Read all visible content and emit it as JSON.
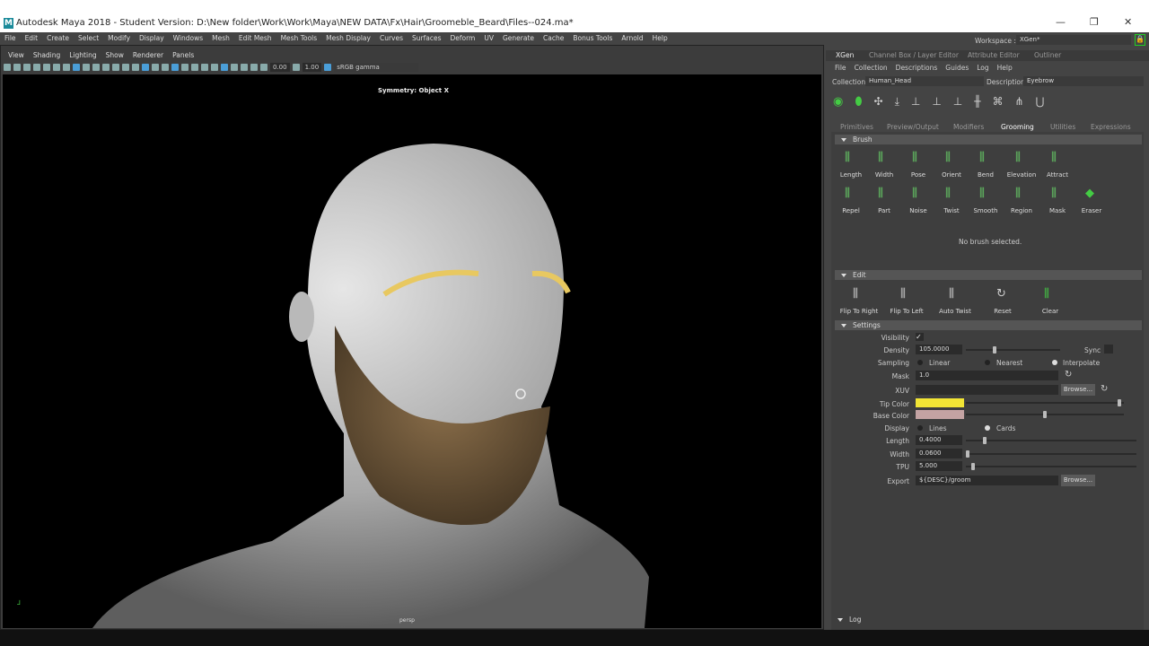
{
  "window": {
    "title": "Autodesk Maya 2018 - Student Version: D:\\New folder\\Work\\Work\\Maya\\NEW DATA\\Fx\\Hair\\Groomeble_Beard\\Files--024.ma*",
    "logo": "M"
  },
  "menu": [
    "File",
    "Edit",
    "Create",
    "Select",
    "Modify",
    "Display",
    "Windows",
    "Mesh",
    "Edit Mesh",
    "Mesh Tools",
    "Mesh Display",
    "Curves",
    "Surfaces",
    "Deform",
    "UV",
    "Generate",
    "Cache",
    "Bonus Tools",
    "Arnold",
    "Help"
  ],
  "panel_menu": [
    "View",
    "Shading",
    "Lighting",
    "Show",
    "Renderer",
    "Panels"
  ],
  "toolbar": {
    "exposure": "0.00",
    "gamma": "1.00",
    "color_space": "sRGB gamma"
  },
  "viewport": {
    "symmetry": "Symmetry: Object X",
    "camera": "persp"
  },
  "workspace": {
    "label": "Workspace :",
    "value": "XGen*"
  },
  "right_tabs": [
    "XGen",
    "Channel Box / Layer Editor",
    "Attribute Editor",
    "Outliner"
  ],
  "xgen_menu": [
    "File",
    "Collection",
    "Descriptions",
    "Guides",
    "Log",
    "Help"
  ],
  "collection": {
    "label": "Collection",
    "value": "Human_Head"
  },
  "description": {
    "label": "Description",
    "value": "Eyebrow"
  },
  "sub_tabs": [
    "Primitives",
    "Preview/Output",
    "Modifiers",
    "Grooming",
    "Utilities",
    "Expressions"
  ],
  "brush": {
    "title": "Brush",
    "tools": [
      "Length",
      "Width",
      "Pose",
      "Orient",
      "Bend",
      "Elevation",
      "Attract",
      "Repel",
      "Part",
      "Noise",
      "Twist",
      "Smooth",
      "Region",
      "Mask",
      "Eraser"
    ],
    "status": "No brush selected."
  },
  "edit": {
    "title": "Edit",
    "tools": [
      "Flip To Right",
      "Flip To Left",
      "Auto Twist",
      "Reset",
      "Clear"
    ]
  },
  "settings": {
    "title": "Settings",
    "visibility": "Visibility",
    "density_label": "Density",
    "density": "105.0000",
    "density_slider": 0.3,
    "sync": "Sync",
    "sampling": "Sampling",
    "sampling_opts": [
      "Linear",
      "Nearest",
      "Interpolate"
    ],
    "mask_label": "Mask",
    "mask": "1.0",
    "xuv": "XUV",
    "browse": "Browse...",
    "tip_color_label": "Tip Color",
    "tip_color": "#f2e535",
    "tip_slider": 0.98,
    "base_color_label": "Base Color",
    "base_color": "#c4a3a3",
    "base_slider": 0.5,
    "display": "Display",
    "display_opts": [
      "Lines",
      "Cards"
    ],
    "length_label": "Length",
    "length": "0.4000",
    "length_slider": 0.1,
    "width_label": "Width",
    "width": "0.0600",
    "width_slider": 0.0,
    "tpu_label": "TPU",
    "tpu": "5.000",
    "tpu_slider": 0.03,
    "export_label": "Export",
    "export": "${DESC}/groom"
  },
  "log": "Log"
}
